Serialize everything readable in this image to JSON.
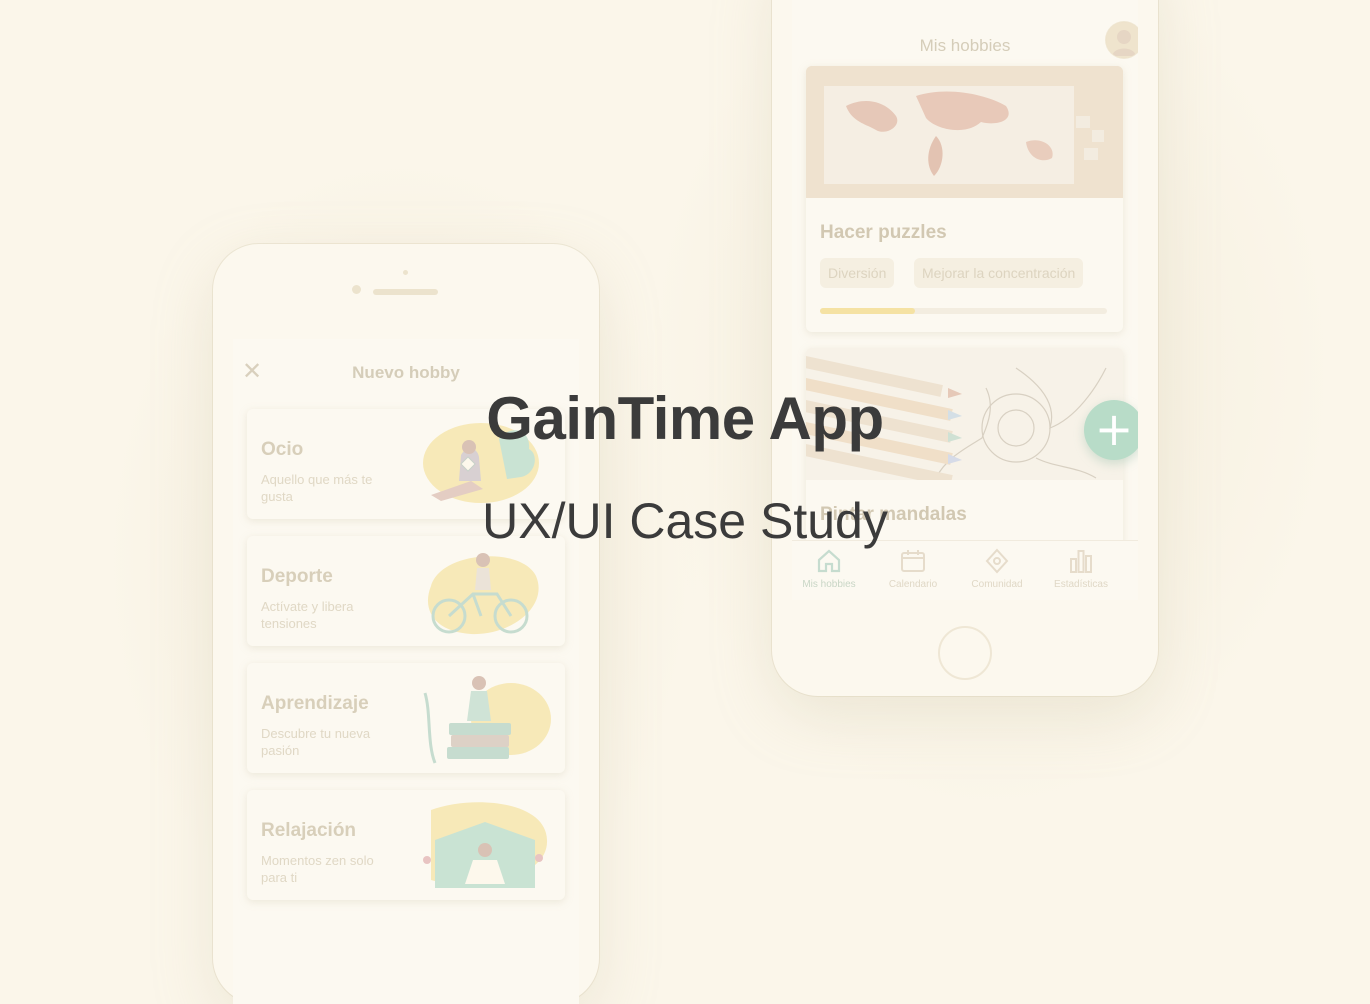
{
  "headline": {
    "title": "GainTime App",
    "subtitle": "UX/UI Case Study"
  },
  "left_phone": {
    "title": "Nuevo hobby",
    "close_icon": "close-icon",
    "categories": [
      {
        "name": "Ocio",
        "description": "Aquello que más te gusta",
        "illustration": "person-reading-plant-illustration"
      },
      {
        "name": "Deporte",
        "description": "Actívate y libera tensiones",
        "illustration": "person-cycling-illustration"
      },
      {
        "name": "Aprendizaje",
        "description": "Descubre tu nueva pasión",
        "illustration": "person-sitting-on-books-illustration"
      },
      {
        "name": "Relajación",
        "description": "Momentos zen solo para ti",
        "illustration": "person-meditating-illustration"
      }
    ]
  },
  "right_phone": {
    "title": "Mis hobbies",
    "hobbies": [
      {
        "name": "Hacer puzzles",
        "tags": [
          "Diversión",
          "Mejorar la concentración"
        ],
        "progress": 0.33,
        "image": "world-map-puzzle-photo"
      },
      {
        "name": "Pintar mandalas",
        "image": "colored-pencils-mandala-photo"
      }
    ],
    "fab_icon": "plus-icon",
    "tabs": [
      {
        "label": "Mis hobbies",
        "icon": "home-icon",
        "active": true
      },
      {
        "label": "Calendario",
        "icon": "calendar-icon",
        "active": false
      },
      {
        "label": "Comunidad",
        "icon": "community-icon",
        "active": false
      },
      {
        "label": "Estadísticas",
        "icon": "bar-chart-icon",
        "active": false
      }
    ]
  },
  "colors": {
    "background": "#fbf6ea",
    "headline_text": "#3b3b3b",
    "fab": "#b8dcc8",
    "progress": "#f5e2a3"
  }
}
